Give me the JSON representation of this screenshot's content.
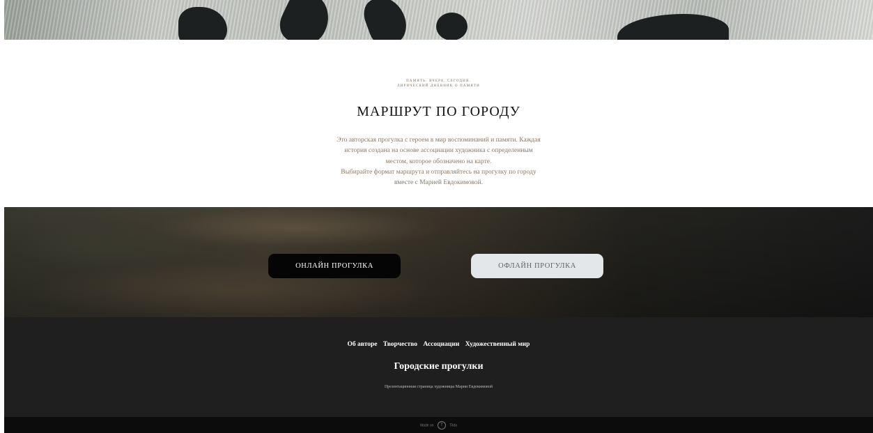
{
  "intro": {
    "eyebrow_line1": "Память. Вчера. Сегодня.",
    "eyebrow_line2": "Лирический дневник о памяти",
    "title": "МАРШРУТ ПО ГОРОДУ",
    "description_line1": "Это авторская прогулка с героем в мир воспоминаний и памяти. Каждая",
    "description_line2": "история создана на основе ассоциации художника с определенным",
    "description_line3": "местом, которое обозначено на карте.",
    "description_line4": "Выбирайте формат маршрута и отправляйтесь на прогулку по городу",
    "description_line5": "вместе с Марией Евдокимовой."
  },
  "buttons": {
    "online": "ОНЛАЙН ПРОГУЛКА",
    "offline": "ОФЛАЙН ПРОГУЛКА"
  },
  "footer": {
    "nav": [
      "Об авторе",
      "Творчество",
      "Ассоциации",
      "Художественный мир"
    ],
    "site_title": "Городские прогулки",
    "site_subtitle": "Презентационная страница художницы Марии Евдокимовой"
  },
  "tilda": {
    "made_on": "Made on",
    "logo_letter": "T",
    "brand": "Tilda"
  },
  "colors": {
    "footer_bg": "#1f1f1f",
    "online_button": "#050505",
    "offline_button": "#e4e7ea"
  }
}
